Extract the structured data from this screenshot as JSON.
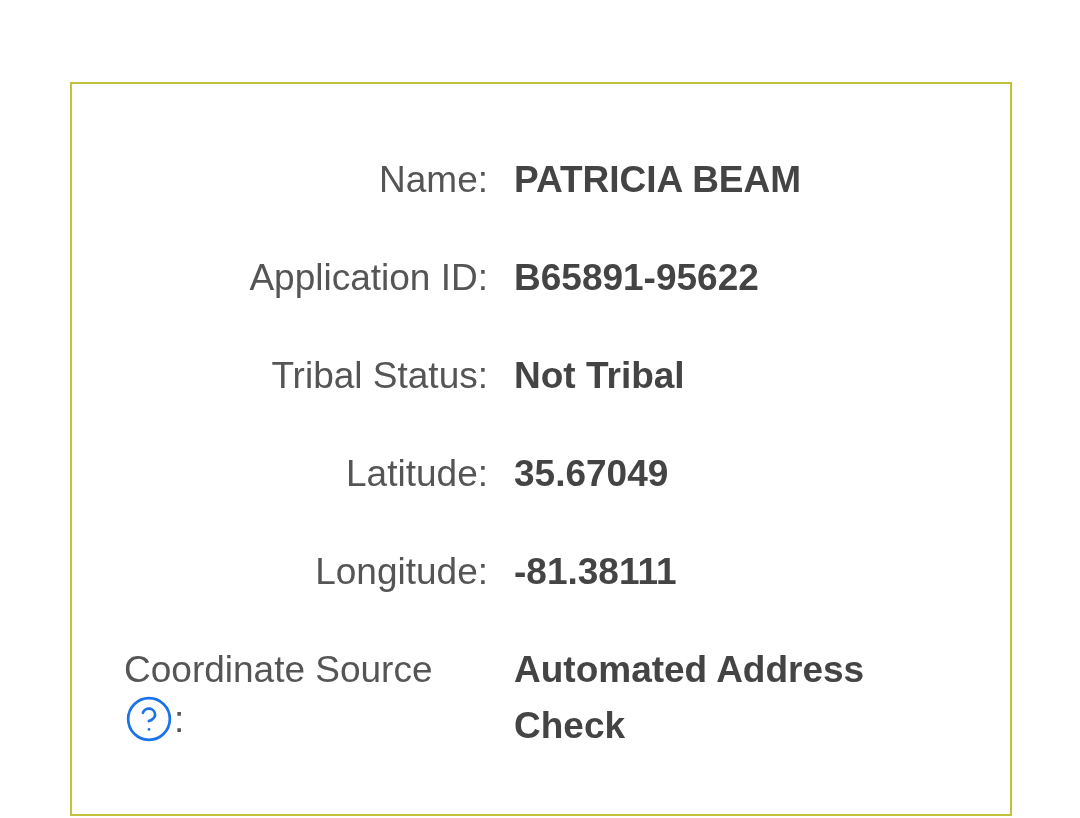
{
  "fields": [
    {
      "kind": "plain",
      "label": "Name:",
      "value": "PATRICIA BEAM"
    },
    {
      "kind": "plain",
      "label": "Application ID:",
      "value": "B65891-95622"
    },
    {
      "kind": "plain",
      "label": "Tribal Status:",
      "value": "Not Tribal"
    },
    {
      "kind": "plain",
      "label": "Latitude:",
      "value": "35.67049"
    },
    {
      "kind": "plain",
      "label": "Longitude:",
      "value": "-81.38111"
    },
    {
      "kind": "help",
      "label": "Coordinate Source",
      "label_suffix": ":",
      "value": "Automated Address Check"
    }
  ]
}
